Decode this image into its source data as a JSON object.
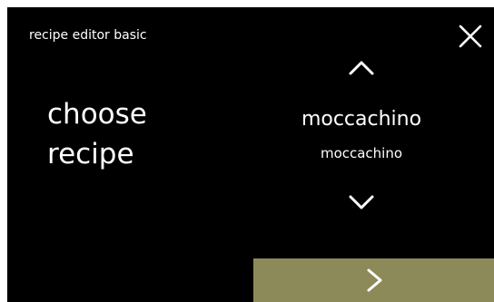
{
  "header": {
    "title": "recipe editor basic",
    "close_icon": "close-icon"
  },
  "prompt": {
    "line1": "choose",
    "line2": "recipe"
  },
  "selector": {
    "up_icon": "chevron-up-icon",
    "current_recipe": "moccachino",
    "current_recipe_sub": "moccachino",
    "down_icon": "chevron-down-icon"
  },
  "footer": {
    "next_icon": "chevron-right-icon",
    "next_color": "#8c8a59"
  },
  "colors": {
    "background": "#000000",
    "text": "#ffffff",
    "accent": "#8c8a59"
  }
}
